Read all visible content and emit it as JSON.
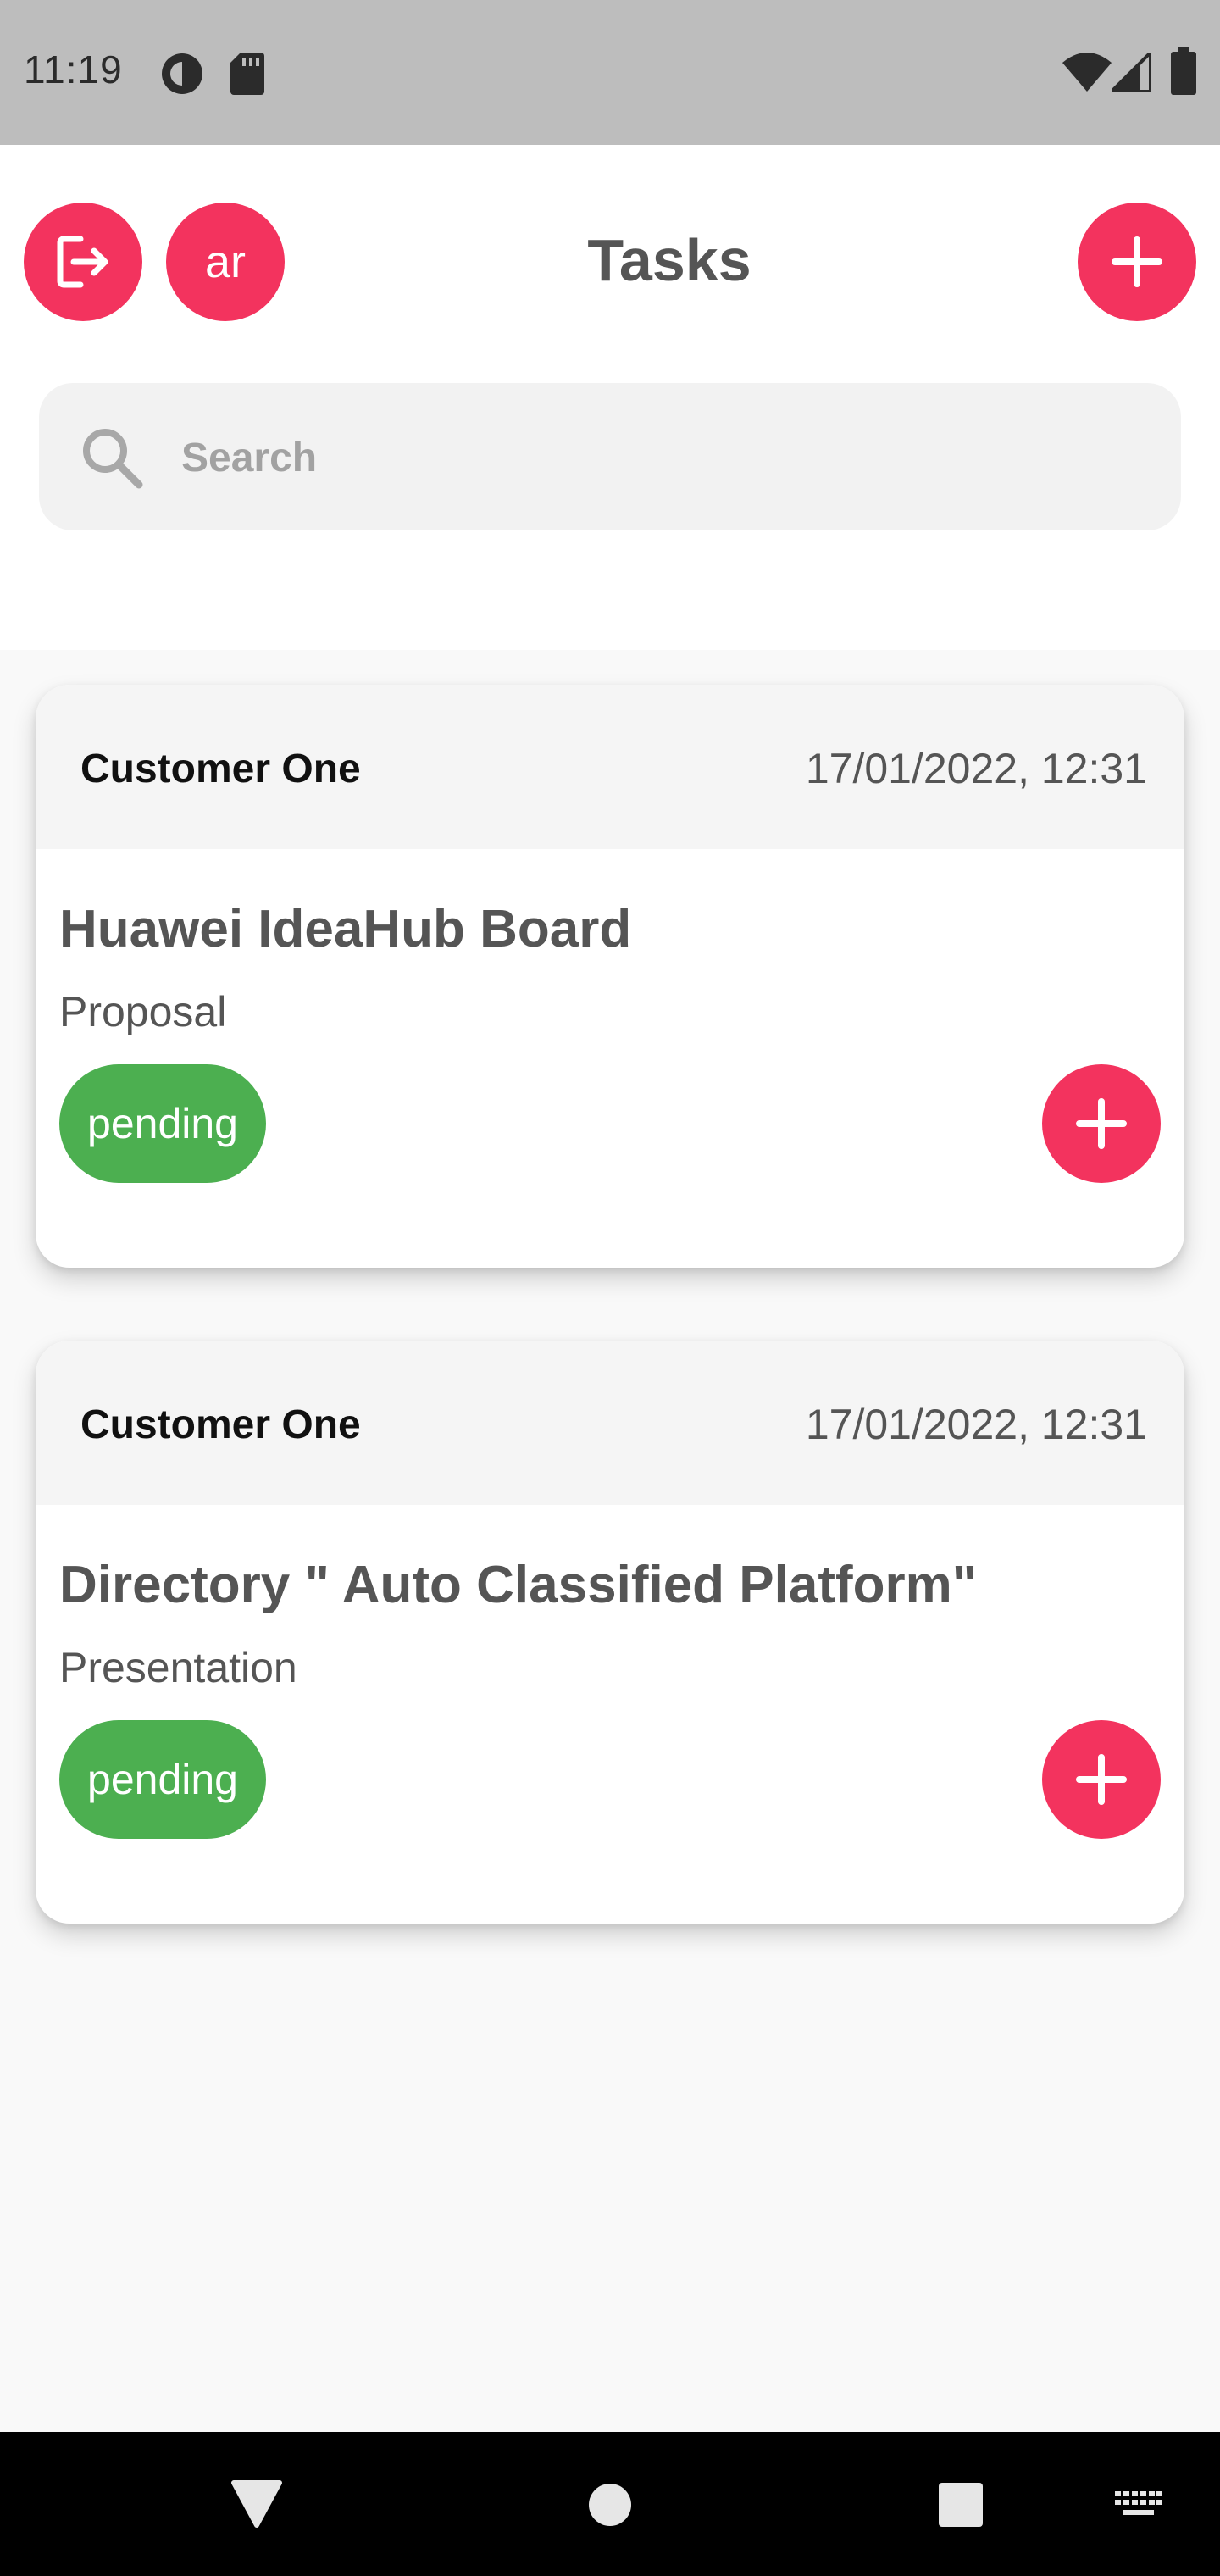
{
  "status_bar": {
    "time": "11:19",
    "icons": [
      "data-saver-icon",
      "sd-card-icon",
      "wifi-icon",
      "signal-icon",
      "battery-icon"
    ]
  },
  "header": {
    "title": "Tasks",
    "language_label": "ar",
    "logout_icon": "logout-icon",
    "add_icon": "plus-icon"
  },
  "search": {
    "placeholder": "Search",
    "value": ""
  },
  "tasks": [
    {
      "customer": "Customer One",
      "date": "17/01/2022, 12:31",
      "title": "Huawei IdeaHub Board",
      "type": "Proposal",
      "status": "pending"
    },
    {
      "customer": "Customer One",
      "date": "17/01/2022, 12:31",
      "title": "Directory \" Auto Classified Platform\"",
      "type": "Presentation",
      "status": "pending"
    }
  ],
  "colors": {
    "accent": "#f3335e",
    "status_pending": "#4caf50",
    "status_bar": "#bdbdbd",
    "nav_bar": "#000000"
  },
  "nav_bar": {
    "icons": [
      "back-icon",
      "home-icon",
      "recents-icon",
      "keyboard-icon"
    ]
  }
}
